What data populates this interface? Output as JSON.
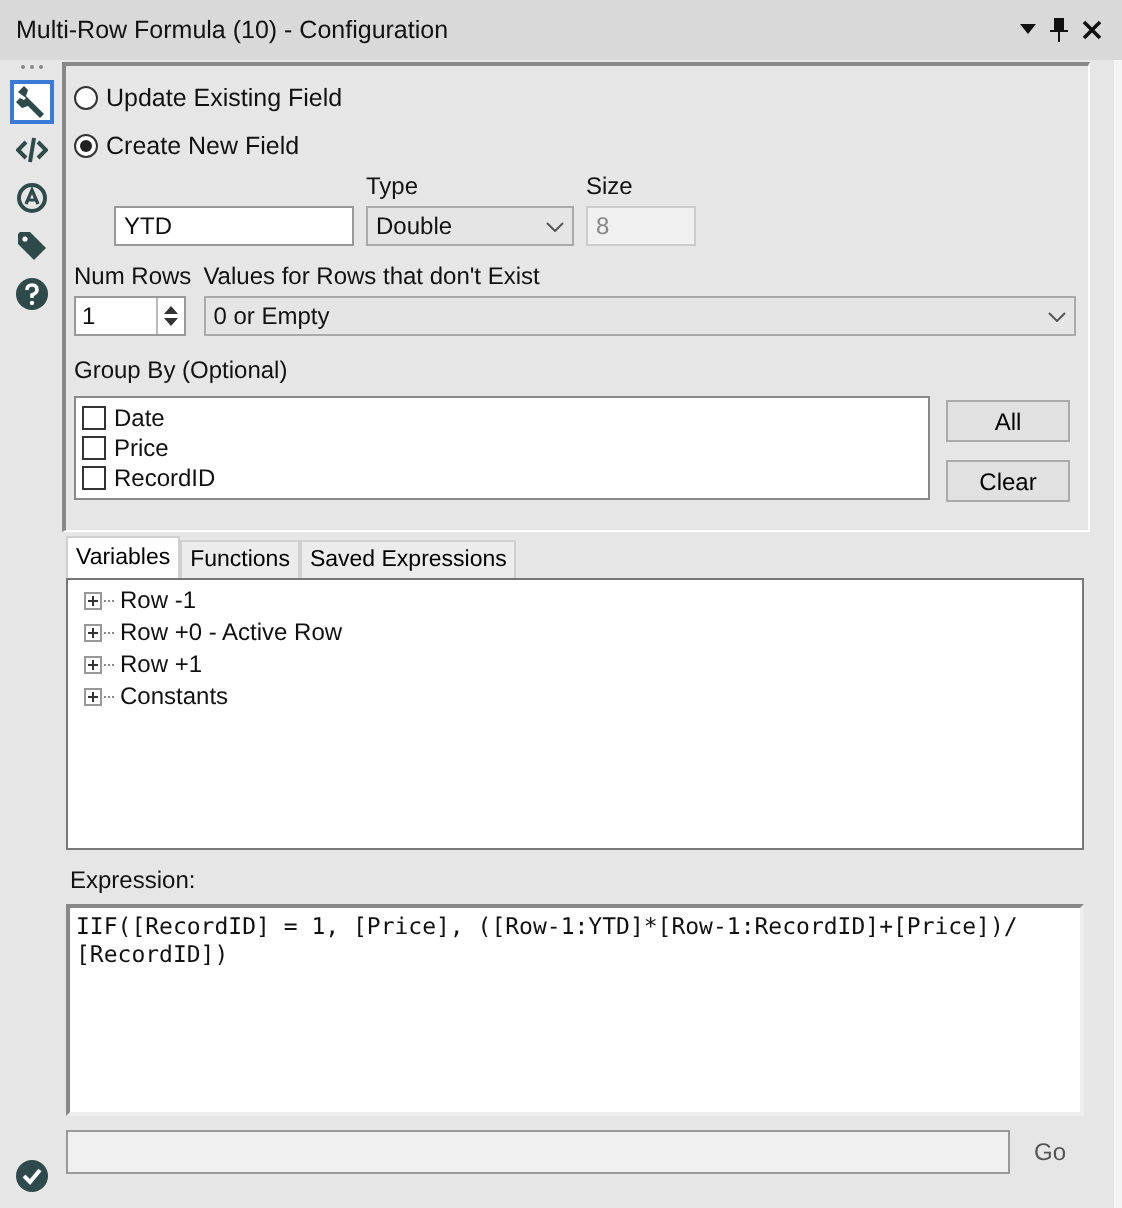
{
  "window": {
    "title": "Multi-Row Formula (10) - Configuration"
  },
  "sidebar": {
    "tools": [
      {
        "kind": "wrench",
        "selected": true
      },
      {
        "kind": "code",
        "selected": false
      },
      {
        "kind": "target",
        "selected": false
      },
      {
        "kind": "tag",
        "selected": false
      },
      {
        "kind": "help",
        "selected": false
      }
    ]
  },
  "field_mode": [
    {
      "label": "Update Existing Field",
      "selected": false
    },
    {
      "label": "Create New  Field",
      "selected": true
    }
  ],
  "new_field": {
    "name": "YTD",
    "type_label": "Type",
    "type": "Double",
    "size_label": "Size",
    "size": "8",
    "size_disabled": true
  },
  "num_rows": {
    "label": "Num Rows",
    "value": "1"
  },
  "missing_rows": {
    "label": "Values for Rows that don't Exist",
    "value": "0 or Empty"
  },
  "group_by": {
    "label": "Group By (Optional)",
    "items": [
      {
        "label": "Date",
        "checked": false
      },
      {
        "label": "Price",
        "checked": false
      },
      {
        "label": "RecordID",
        "checked": false
      }
    ],
    "buttons": [
      "All",
      "Clear"
    ]
  },
  "tabs": [
    {
      "label": "Variables",
      "selected": true
    },
    {
      "label": "Functions",
      "selected": false
    },
    {
      "label": "Saved Expressions",
      "selected": false
    }
  ],
  "tree": [
    {
      "label": "Row -1",
      "expanded": false
    },
    {
      "label": "Row +0 - Active Row",
      "expanded": false
    },
    {
      "label": "Row +1",
      "expanded": false
    },
    {
      "label": "Constants",
      "expanded": false
    }
  ],
  "expression": {
    "label": "Expression:",
    "value": "IIF([RecordID] = 1, [Price], ([Row-1:YTD]*[Row-1:RecordID]+[Price])/\n[RecordID])"
  },
  "go": {
    "button": "Go"
  },
  "status": {
    "valid": true
  }
}
